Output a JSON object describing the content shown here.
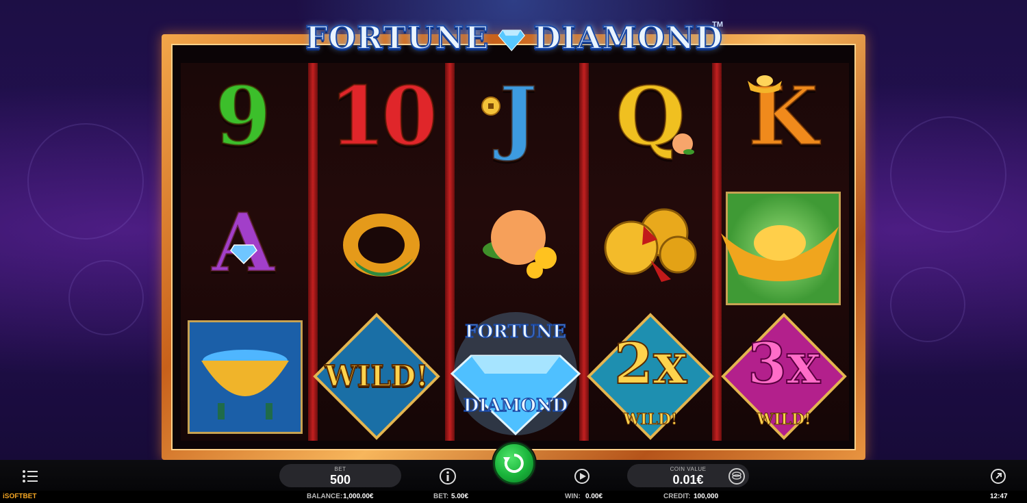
{
  "game": {
    "logo_word_left": "FORTUNE",
    "logo_word_right": "DIAMOND",
    "trademark": "TM"
  },
  "reels": [
    {
      "symbols": [
        {
          "type": "card",
          "text": "9",
          "color": "#3cbf2b"
        },
        {
          "type": "card",
          "text": "A",
          "color": "#a23fc9"
        },
        {
          "type": "pot-of-jewels"
        }
      ]
    },
    {
      "symbols": [
        {
          "type": "card",
          "text": "10",
          "color": "#e0262a"
        },
        {
          "type": "jade-ring"
        },
        {
          "type": "wild",
          "text": "WILD!"
        }
      ]
    },
    {
      "symbols": [
        {
          "type": "card",
          "text": "J",
          "color": "#3d9be0"
        },
        {
          "type": "peach-blossom"
        },
        {
          "type": "fortune-diamond",
          "text_top": "FORTUNE",
          "text_bottom": "DIAMOND"
        }
      ]
    },
    {
      "symbols": [
        {
          "type": "card",
          "text": "Q",
          "color": "#f0c020"
        },
        {
          "type": "gold-coins"
        },
        {
          "type": "wild-multiplier",
          "text": "2x",
          "sub": "WILD!"
        }
      ]
    },
    {
      "symbols": [
        {
          "type": "card",
          "text": "K",
          "color": "#f08a1c"
        },
        {
          "type": "gold-ingot"
        },
        {
          "type": "wild-multiplier",
          "text": "3x",
          "sub": "WILD!"
        }
      ]
    }
  ],
  "controls": {
    "bet_label": "BET",
    "bet_value": "500",
    "coin_value_label": "COIN VALUE",
    "coin_value": "0.01€",
    "menu_icon": "menu-icon",
    "info_icon": "info-icon",
    "autoplay_icon": "autoplay-icon",
    "coins_icon": "coins-icon",
    "spin_icon": "spin-icon",
    "external_icon": "external-link-icon"
  },
  "status": {
    "brand": "iSOFTBET",
    "balance_label": "BALANCE:",
    "balance_value": "1,000.00€",
    "bet_label": "BET:",
    "bet_value": "5.00€",
    "win_label": "WIN:",
    "win_value": "0.00€",
    "credit_label": "CREDIT:",
    "credit_value": "100,000",
    "clock": "12:47"
  },
  "colors": {
    "frame": "#e08a35",
    "reel_separator": "#c22020",
    "spin_button": "#19b33a"
  }
}
